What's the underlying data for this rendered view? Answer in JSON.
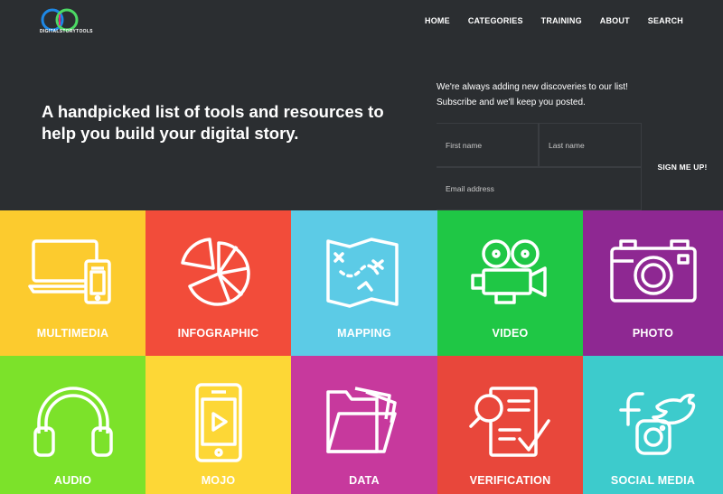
{
  "header": {
    "logo_text": "DIGITALSTORYTOOLS",
    "nav": [
      "HOME",
      "CATEGORIES",
      "TRAINING",
      "ABOUT",
      "SEARCH"
    ]
  },
  "hero": {
    "headline": "A handpicked list of tools and resources to help you build your digital story."
  },
  "subscribe": {
    "line1": "We're always adding new discoveries to our list!",
    "line2": "Subscribe and we'll keep you posted.",
    "first_name_placeholder": "First name",
    "last_name_placeholder": "Last name",
    "email_placeholder": "Email address",
    "button_label": "SIGN ME UP!"
  },
  "categories": [
    {
      "label": "MULTIMEDIA",
      "color": "#fccb2e",
      "icon": "devices-icon"
    },
    {
      "label": "INFOGRAPHIC",
      "color": "#f24c3a",
      "icon": "pie-chart-icon"
    },
    {
      "label": "MAPPING",
      "color": "#5ccbe6",
      "icon": "treasure-map-icon"
    },
    {
      "label": "VIDEO",
      "color": "#1fc745",
      "icon": "film-projector-icon"
    },
    {
      "label": "PHOTO",
      "color": "#8e2892",
      "icon": "camera-icon"
    },
    {
      "label": "AUDIO",
      "color": "#7ce22a",
      "icon": "headphones-icon"
    },
    {
      "label": "MOJO",
      "color": "#fdd736",
      "icon": "smartphone-play-icon"
    },
    {
      "label": "DATA",
      "color": "#c7399d",
      "icon": "folder-icon"
    },
    {
      "label": "VERIFICATION",
      "color": "#e8473b",
      "icon": "magnifier-checklist-icon"
    },
    {
      "label": "SOCIAL MEDIA",
      "color": "#3dcbcc",
      "icon": "social-icons-icon"
    }
  ],
  "brand": {
    "ring_blue": "#1e88e5",
    "ring_green": "#4cd964",
    "ring_magenta": "#e0267d",
    "dark_bg": "#2b2e31"
  }
}
